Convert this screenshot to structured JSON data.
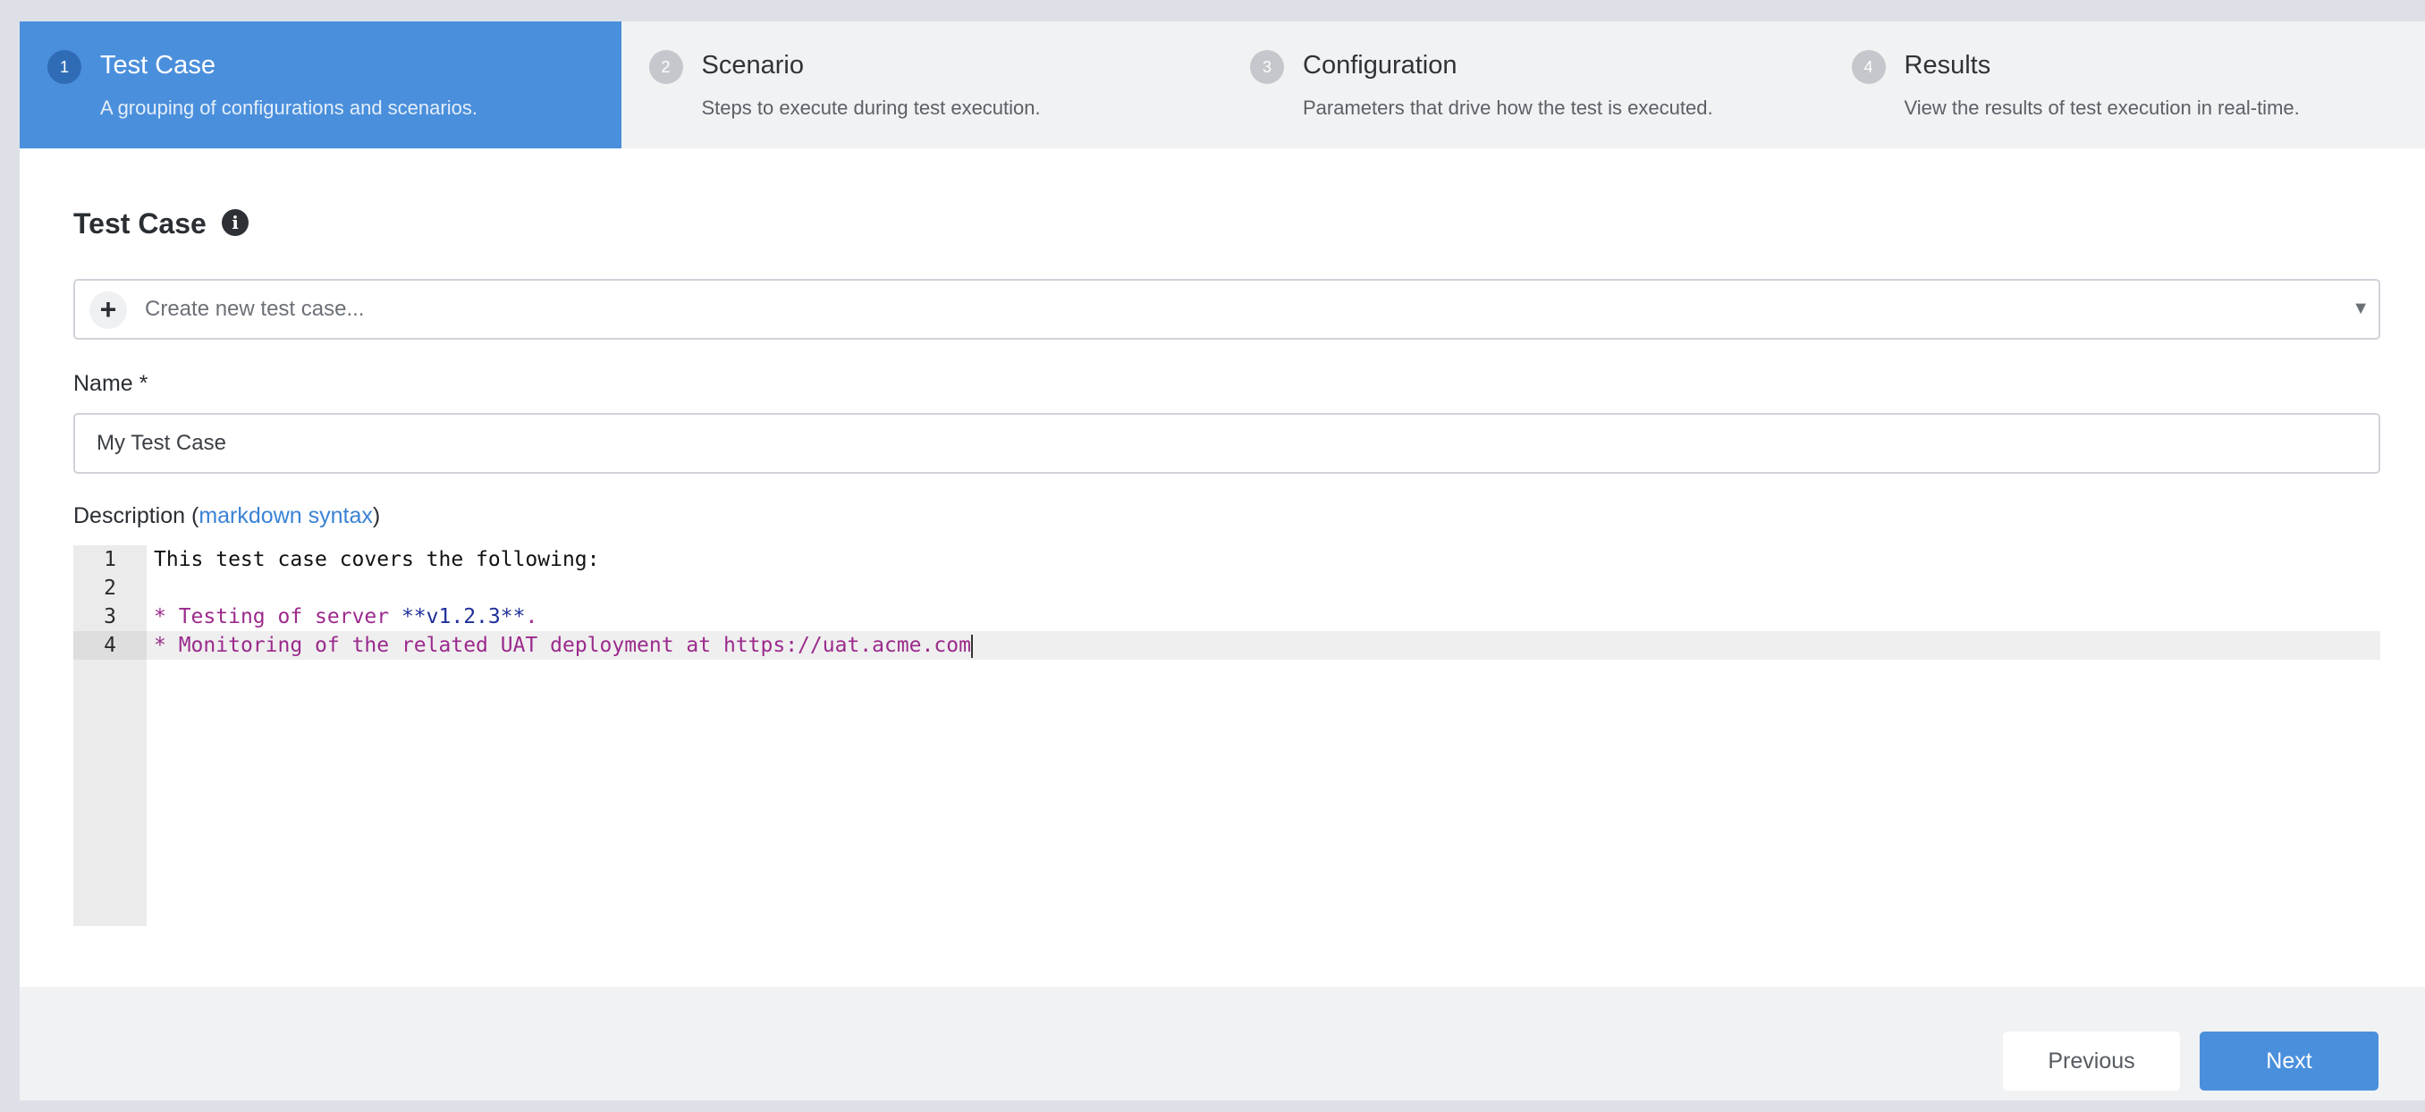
{
  "steps": [
    {
      "number": "1",
      "title": "Test Case",
      "description": "A grouping of configurations and scenarios.",
      "active": true
    },
    {
      "number": "2",
      "title": "Scenario",
      "description": "Steps to execute during test execution.",
      "active": false
    },
    {
      "number": "3",
      "title": "Configuration",
      "description": "Parameters that drive how the test is executed.",
      "active": false
    },
    {
      "number": "4",
      "title": "Results",
      "description": "View the results of test execution in real-time.",
      "active": false
    }
  ],
  "section": {
    "title": "Test Case",
    "info_icon": "info-icon"
  },
  "test_case_select": {
    "placeholder": "Create new test case...",
    "add_icon": "plus-icon",
    "caret_icon": "caret-down-icon"
  },
  "name_field": {
    "label": "Name *",
    "value": "My Test Case"
  },
  "description": {
    "label_prefix": "Description (",
    "link_text": "markdown syntax",
    "label_suffix": ")",
    "lines": [
      {
        "number": "1",
        "text": "This test case covers the following:"
      },
      {
        "number": "2",
        "text": ""
      },
      {
        "number": "3",
        "list_marker": "* ",
        "text_before": "Testing of server ",
        "strong": "**v1.2.3**",
        "text_after": "."
      },
      {
        "number": "4",
        "list_marker": "* ",
        "text_before": "Monitoring of the related UAT deployment at https://uat.acme.com"
      }
    ]
  },
  "footer": {
    "previous_label": "Previous",
    "next_label": "Next"
  },
  "colors": {
    "accent": "#4a8fdc",
    "markdown_list": "#9b2a8c",
    "markdown_strong": "#1f2f9a"
  }
}
